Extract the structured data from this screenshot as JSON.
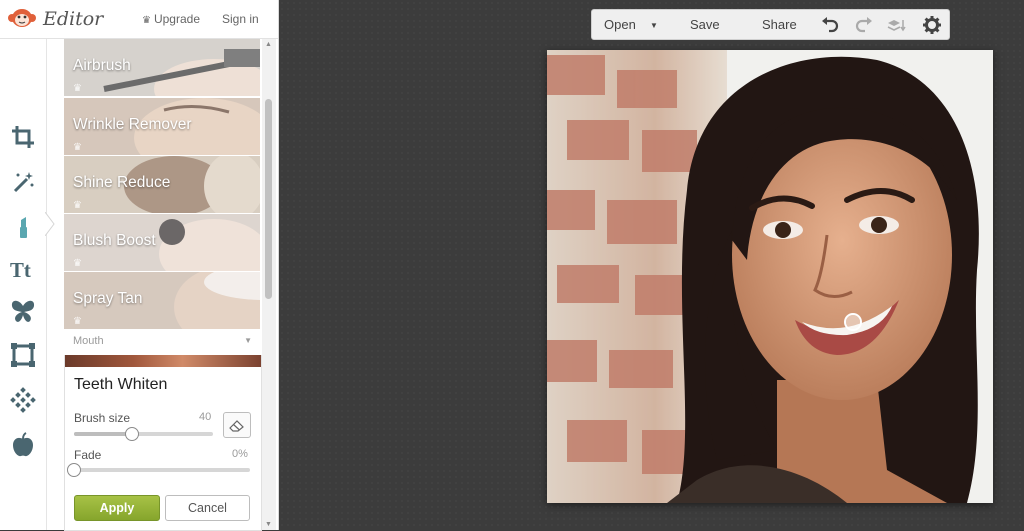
{
  "header": {
    "brand": "Editor",
    "upgrade_label": "Upgrade",
    "signin_label": "Sign in"
  },
  "tools": [
    {
      "name": "crop-icon"
    },
    {
      "name": "magic-wand-icon"
    },
    {
      "name": "lipstick-icon",
      "active": true
    },
    {
      "name": "text-icon"
    },
    {
      "name": "butterfly-icon"
    },
    {
      "name": "frame-icon"
    },
    {
      "name": "texture-icon"
    },
    {
      "name": "apple-icon"
    }
  ],
  "effects": [
    {
      "label": "Airbrush",
      "premium": true
    },
    {
      "label": "Wrinkle Remover",
      "premium": true
    },
    {
      "label": "Shine Reduce",
      "premium": true
    },
    {
      "label": "Blush Boost",
      "premium": true
    },
    {
      "label": "Spray Tan",
      "premium": true
    }
  ],
  "section": {
    "label": "Mouth"
  },
  "teeth_whiten": {
    "title": "Teeth Whiten",
    "brush_size_label": "Brush size",
    "brush_size_value": "40",
    "brush_size_fraction": 0.42,
    "fade_label": "Fade",
    "fade_value": "0%",
    "fade_fraction": 0,
    "apply_label": "Apply",
    "cancel_label": "Cancel"
  },
  "toolbar": {
    "open_label": "Open",
    "save_label": "Save",
    "share_label": "Share"
  },
  "colors": {
    "accent_green": "#8fae33",
    "canvas_bg": "#3c3c3c",
    "logo_orange": "#e0603a",
    "lipstick_teal": "#5aa7b0"
  }
}
